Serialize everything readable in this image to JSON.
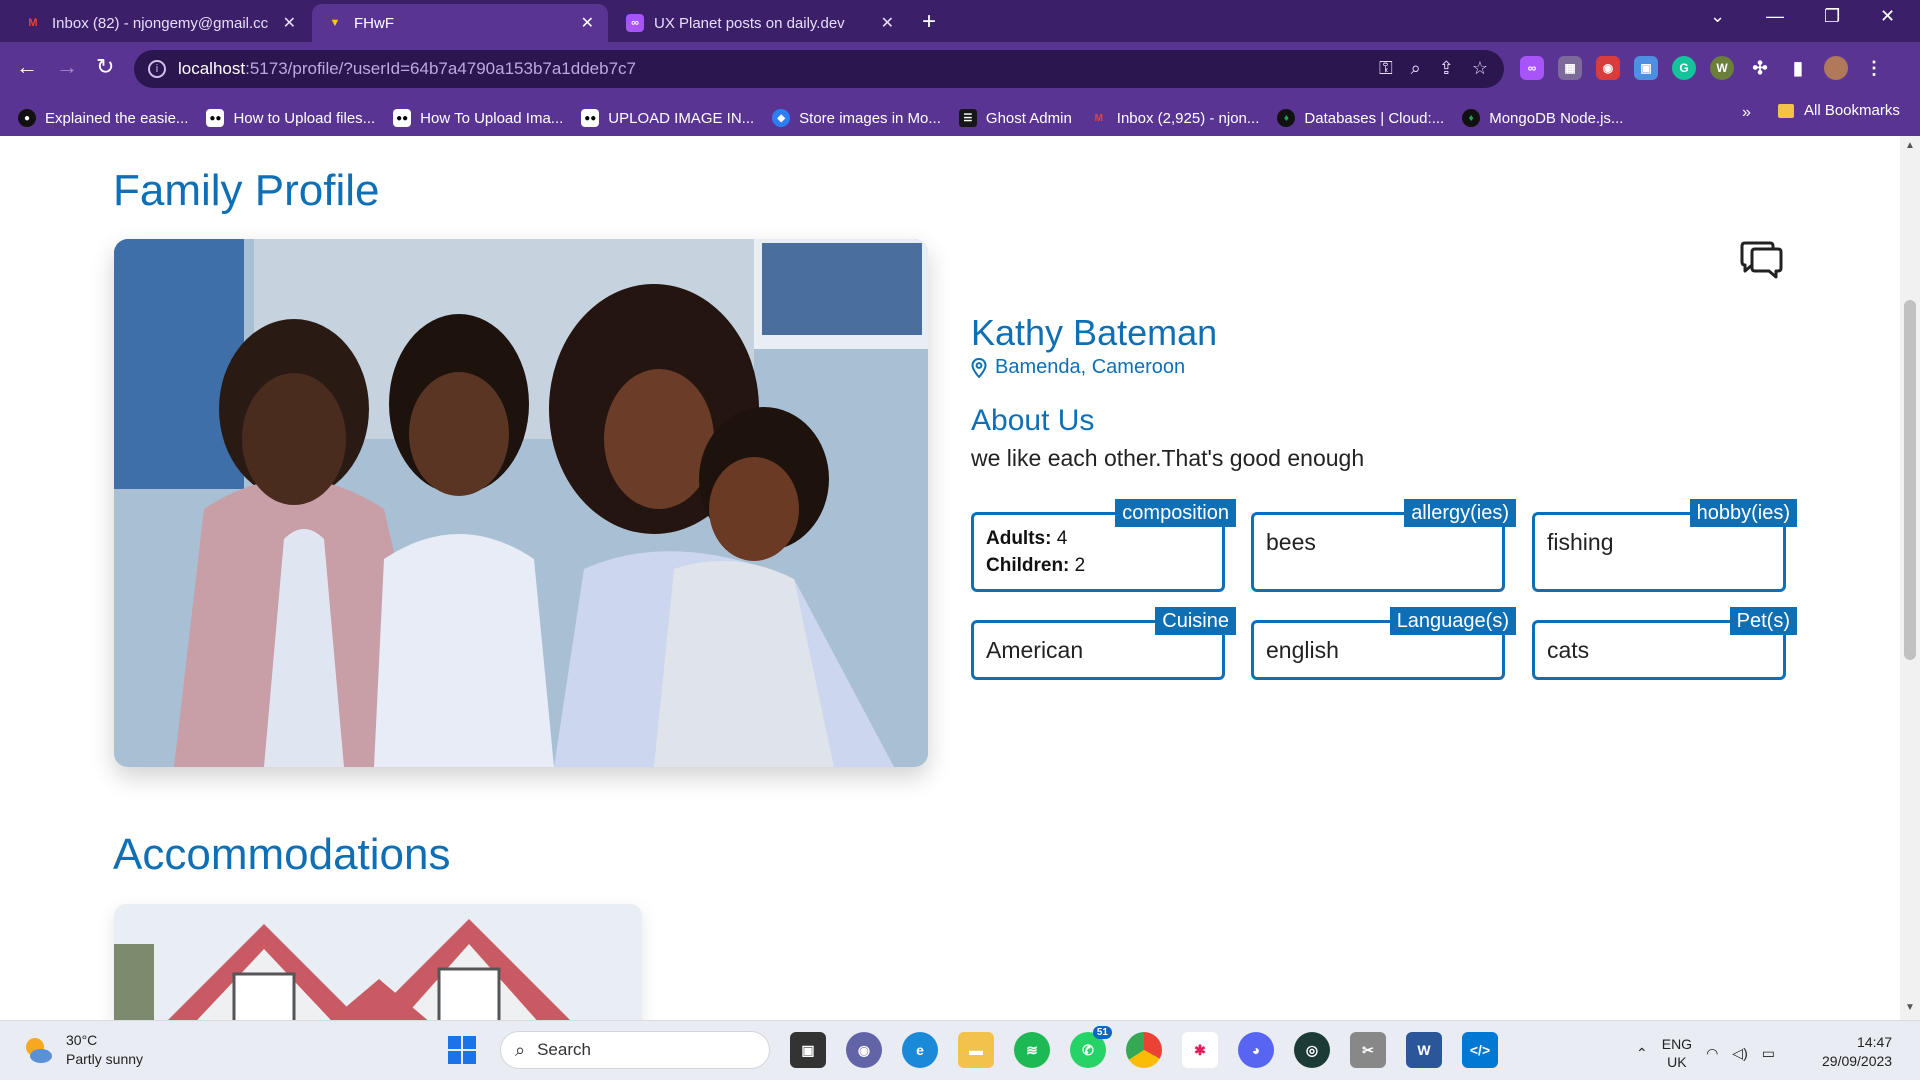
{
  "browser": {
    "tabs": [
      {
        "title": "Inbox (82) - njongemy@gmail.cc",
        "active": false
      },
      {
        "title": "FHwF",
        "active": true
      },
      {
        "title": "UX Planet posts on daily.dev",
        "active": false
      }
    ],
    "url_host": "localhost",
    "url_path": ":5173/profile/?userId=64b7a4790a153b7a1ddeb7c7",
    "bookmarks": [
      "Explained the easie...",
      "How to Upload files...",
      "How To Upload Ima...",
      "UPLOAD IMAGE IN...",
      "Store images in Mo...",
      "Ghost Admin",
      "Inbox (2,925) - njon...",
      "Databases | Cloud:...",
      "MongoDB Node.js..."
    ],
    "bookmarks_more": "»",
    "all_bookmarks": "All Bookmarks"
  },
  "page": {
    "title": "Family Profile",
    "name": "Kathy Bateman",
    "location": "Bamenda, Cameroon",
    "about_title": "About Us",
    "about_text": "we like each other.That's good enough",
    "cards": {
      "composition": {
        "label": "composition",
        "adults_label": "Adults:",
        "adults": "4",
        "children_label": "Children:",
        "children": "2"
      },
      "allergy": {
        "label": "allergy(ies)",
        "value": "bees"
      },
      "hobby": {
        "label": "hobby(ies)",
        "value": "fishing"
      },
      "cuisine": {
        "label": "Cuisine",
        "value": "American"
      },
      "language": {
        "label": "Language(s)",
        "value": "english"
      },
      "pet": {
        "label": "Pet(s)",
        "value": "cats"
      }
    },
    "accommodations_title": "Accommodations"
  },
  "taskbar": {
    "weather_temp": "30°C",
    "weather_desc": "Partly sunny",
    "search_label": "Search",
    "whatsapp_badge": "51",
    "lang_top": "ENG",
    "lang_bottom": "UK",
    "time": "14:47",
    "date": "29/09/2023"
  },
  "colors": {
    "accent": "#0f6fb5",
    "chrome": "#5a3493"
  }
}
